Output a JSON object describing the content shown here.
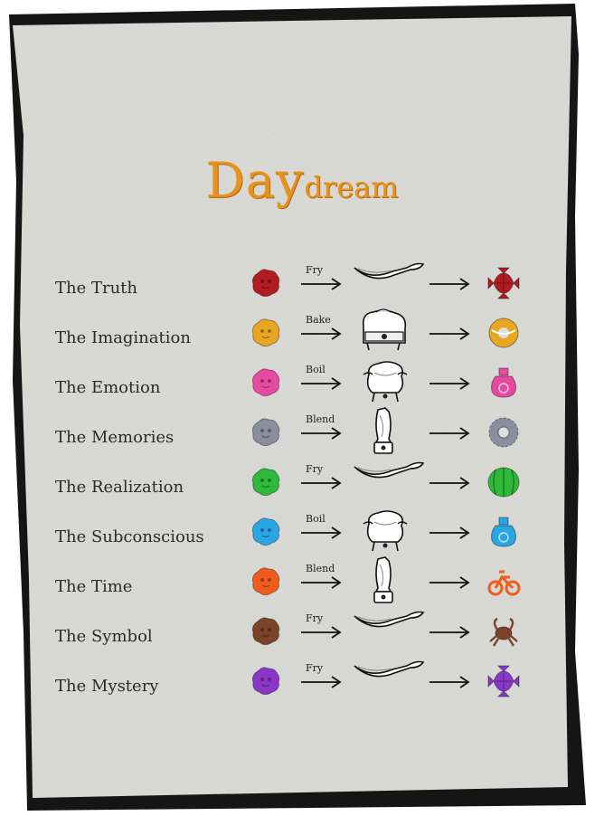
{
  "title": {
    "big": "Day",
    "small": "dream"
  },
  "rows": [
    {
      "label": "The Truth",
      "method": "Fry",
      "tool": "pan",
      "color": "#b01c22",
      "result_shape": "candy"
    },
    {
      "label": "The Imagination",
      "method": "Bake",
      "tool": "oven",
      "color": "#e8a622",
      "result_shape": "donut"
    },
    {
      "label": "The Emotion",
      "method": "Boil",
      "tool": "pot",
      "color": "#e64aa0",
      "result_shape": "bottle"
    },
    {
      "label": "The Memories",
      "method": "Blend",
      "tool": "blender",
      "color": "#8a8e9e",
      "result_shape": "ring"
    },
    {
      "label": "The Realization",
      "method": "Fry",
      "tool": "pan",
      "color": "#2fb83a",
      "result_shape": "melon"
    },
    {
      "label": "The Subconscious",
      "method": "Boil",
      "tool": "pot",
      "color": "#2aa6e4",
      "result_shape": "bottle"
    },
    {
      "label": "The Time",
      "method": "Blend",
      "tool": "blender",
      "color": "#ef5d1e",
      "result_shape": "bike"
    },
    {
      "label": "The Symbol",
      "method": "Fry",
      "tool": "pan",
      "color": "#7b4328",
      "result_shape": "crab"
    },
    {
      "label": "The Mystery",
      "method": "Fry",
      "tool": "pan",
      "color": "#8a36c8",
      "result_shape": "candy"
    }
  ]
}
